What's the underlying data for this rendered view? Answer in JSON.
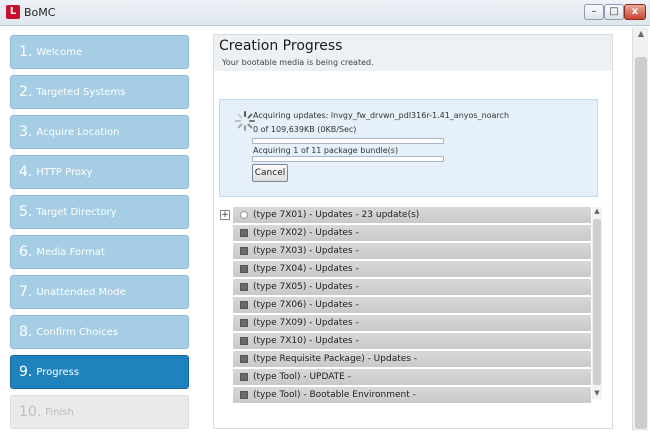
{
  "window": {
    "icon_letter": "L",
    "title": "BoMC",
    "min": "–",
    "max": "□",
    "close": "x"
  },
  "steps": [
    {
      "num": "1.",
      "label": "Welcome"
    },
    {
      "num": "2.",
      "label": "Targeted Systems"
    },
    {
      "num": "3.",
      "label": "Acquire Location"
    },
    {
      "num": "4.",
      "label": "HTTP Proxy"
    },
    {
      "num": "5.",
      "label": "Target Directory"
    },
    {
      "num": "6.",
      "label": "Media Format"
    },
    {
      "num": "7.",
      "label": "Unattended Mode"
    },
    {
      "num": "8.",
      "label": "Confirm Choices"
    },
    {
      "num": "9.",
      "label": "Progress"
    },
    {
      "num": "10.",
      "label": "Finish"
    }
  ],
  "active_step": 9,
  "header": {
    "title": "Creation Progress",
    "subtitle": "Your bootable media is being created."
  },
  "progress": {
    "status": "Acquiring updates: lnvgy_fw_drvwn_pdl316r-1.41_anyos_noarch",
    "bytes": "0 of 109,639KB (0KB/Sec)",
    "bundle": "Acquiring 1 of 11 package bundle(s)",
    "bar1_fraction": 0,
    "bar2_fraction": 0,
    "cancel_label": "Cancel"
  },
  "updates": [
    "(type 7X01) - Updates - 23 update(s)",
    "(type 7X02) - Updates -",
    "(type 7X03) - Updates -",
    "(type 7X04) - Updates -",
    "(type 7X05) - Updates -",
    "(type 7X06) - Updates -",
    "(type 7X09) - Updates -",
    "(type 7X10) - Updates -",
    "(type Requisite Package) - Updates -",
    "(type Tool) - UPDATE -",
    "(type Tool) - Bootable Environment -"
  ],
  "colors": {
    "step": "#a5cde4",
    "active_step": "#1f82bd",
    "disabled_step": "#eaeaea",
    "progress_bg": "#e6f0fa"
  }
}
